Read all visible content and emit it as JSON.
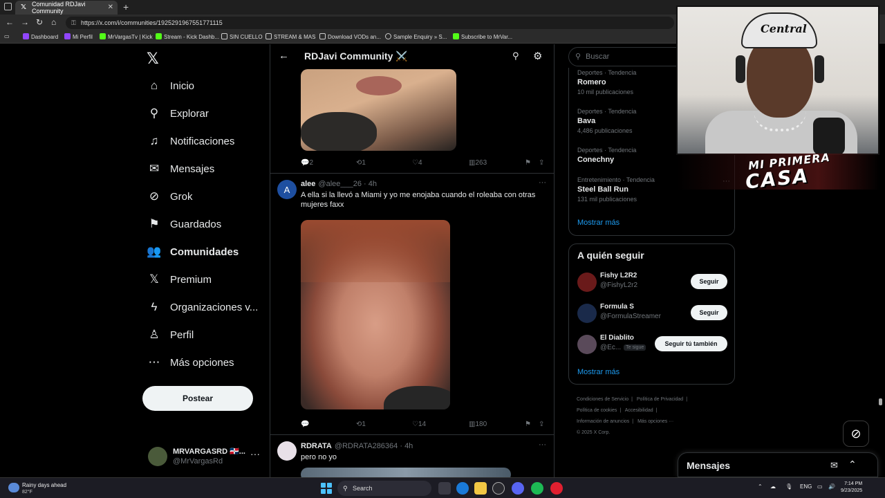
{
  "browser": {
    "tab_title": "Comunidad RDJavi Community",
    "url": "https://x.com/i/communities/1925291967551771115",
    "bookmarks": [
      "Dashboard",
      "Mi Perfil",
      "MrVargasTv | Kick",
      "Stream - Kick Dashb...",
      "SIN CUELLO",
      "STREAM & MAS",
      "Download VODs an...",
      "Sample Enquiry » S...",
      "Subscribe to MrVar..."
    ]
  },
  "nav": {
    "items": [
      "Inicio",
      "Explorar",
      "Notificaciones",
      "Mensajes",
      "Grok",
      "Guardados",
      "Comunidades",
      "Premium",
      "Organizaciones v...",
      "Perfil",
      "Más opciones"
    ],
    "post_button": "Postear",
    "account_name": "MRVARGASRD 🇩🇴...",
    "account_handle": "@MrVargasRd"
  },
  "community": {
    "title": "RDJavi Community ⚔️"
  },
  "tweets": [
    {
      "actions": {
        "replies": "2",
        "retweets": "1",
        "likes": "4",
        "views": "263"
      }
    },
    {
      "avatar_letter": "A",
      "name": "alee",
      "handle": "@alee___26",
      "time": "· 4h",
      "text": "A ella si la llevó a Miami y yo me enojaba cuando el roleaba con otras mujeres faxx",
      "actions": {
        "replies": "",
        "retweets": "1",
        "likes": "14",
        "views": "180"
      }
    },
    {
      "name": "RDRATA",
      "handle": "@RDRATA286364",
      "time": "· 4h",
      "text": "pero no yo"
    }
  ],
  "sidebar": {
    "search_placeholder": "Buscar",
    "trends": [
      {
        "meta": "Deportes · Tendencia",
        "name": "Romero",
        "count": "10 mil publicaciones"
      },
      {
        "meta": "Deportes · Tendencia",
        "name": "Bava",
        "count": "4,486 publicaciones"
      },
      {
        "meta": "Deportes · Tendencia",
        "name": "Conechny",
        "count": ""
      },
      {
        "meta": "Entretenimiento · Tendencia",
        "name": "Steel Ball Run",
        "count": "131 mil publicaciones"
      }
    ],
    "show_more": "Mostrar más",
    "who_to_follow": {
      "title": "A quién seguir",
      "users": [
        {
          "name": "Fishy L2R2",
          "handle": "@FishyL2r2",
          "button": "Seguir",
          "badge": ""
        },
        {
          "name": "Formula S",
          "handle": "@FormulaStreamer",
          "button": "Seguir",
          "badge": ""
        },
        {
          "name": "El Diablito",
          "handle": "@Ec...",
          "button": "Seguir tú también",
          "badge": "Te sigue"
        }
      ],
      "show_more": "Mostrar más"
    },
    "footer": [
      "Condiciones de Servicio",
      "|",
      "Política de Privacidad",
      "|",
      "Política de cookies",
      "|",
      "Accesibilidad",
      "|",
      "Información de anuncios",
      "|",
      "Más opciones ···",
      "© 2025 X Corp."
    ]
  },
  "messages_drawer": {
    "title": "Mensajes"
  },
  "webcam": {
    "cap_text": "Central",
    "banner_line1": "MI PRIMERA",
    "banner_line2": "CASA"
  },
  "taskbar": {
    "weather_text": "Rainy days ahead",
    "weather_temp": "82°F",
    "search_label": "Search",
    "lang": "ENG",
    "time": "7:14 PM",
    "date": "9/23/2025"
  }
}
